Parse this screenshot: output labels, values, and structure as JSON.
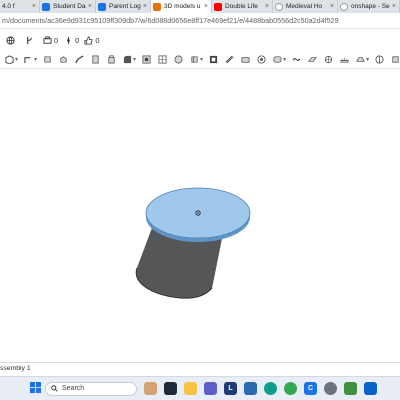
{
  "browser": {
    "tabs": [
      {
        "title": "4.0 f",
        "icon_color": "#3b78d8",
        "active": false
      },
      {
        "title": "Student Das",
        "icon_color": "#1a73e8",
        "active": false
      },
      {
        "title": "Parent LogV",
        "icon_color": "#1a73e8",
        "active": false
      },
      {
        "title": "3D models u",
        "icon_color": "#e8710a",
        "active": true
      },
      {
        "title": "Double Life",
        "icon_color": "#ff0000",
        "active": false
      },
      {
        "title": "Medieval Ho",
        "icon_color": "#9aa0a6",
        "active": false
      },
      {
        "title": "onshape - Se",
        "icon_color": "#9aa0a6",
        "active": false
      }
    ],
    "close_glyph": "×",
    "url": "m/documents/ac36e9d931c95109ff309db7/w/6d088d0656e8ff17e469ef21/e/4488bab0556d2c50a2d4f529"
  },
  "header": {
    "print_count": "0",
    "branch_count": "0",
    "like_count": "0"
  },
  "toolbar": {
    "icons": [
      "box-icon",
      "sketch-icon",
      "extrude-icon",
      "revolve-icon",
      "sweep-icon",
      "loft-icon",
      "thicken-icon",
      "fillet-icon",
      "chamfer-icon",
      "draft-icon",
      "shell-icon",
      "hole-icon",
      "boolean-icon",
      "split-icon",
      "transform-icon",
      "pattern-icon",
      "mirror-icon",
      "helix-icon",
      "plane-icon",
      "mate-connector-icon",
      "measure-icon",
      "view-icon",
      "section-icon",
      "appearance-icon",
      "sheet-metal-icon",
      "part-studio-icon",
      "more-icon",
      "options-icon"
    ]
  },
  "model": {
    "top_face_color": "#9fc8ec",
    "edge_color": "#5e95c9",
    "body_color": "#545657",
    "shade_color": "#2f3132"
  },
  "bottom_tab": {
    "label": "ssembly 1"
  },
  "taskbar": {
    "search_label": "Search",
    "apps": [
      {
        "name": "widgets-icon",
        "color": "#3b82f6",
        "glyph": ""
      },
      {
        "name": "task-view-icon",
        "color": "#1e293b",
        "glyph": ""
      },
      {
        "name": "explorer-icon",
        "color": "#f6c343",
        "glyph": ""
      },
      {
        "name": "teams-icon",
        "color": "#5b5fc7",
        "glyph": ""
      },
      {
        "name": "l-app-icon",
        "color": "#1f3b73",
        "glyph": "L"
      },
      {
        "name": "store-icon",
        "color": "#2b6cb0",
        "glyph": ""
      },
      {
        "name": "edge-icon",
        "color": "#0e9f8a",
        "glyph": ""
      },
      {
        "name": "chrome-icon",
        "color": "#34a853",
        "glyph": ""
      },
      {
        "name": "c-app-icon",
        "color": "#1a73e8",
        "glyph": "C"
      },
      {
        "name": "settings-icon",
        "color": "#6b7280",
        "glyph": ""
      },
      {
        "name": "minecraft-icon",
        "color": "#3f8f3f",
        "glyph": ""
      },
      {
        "name": "outlook-icon",
        "color": "#0a64c8",
        "glyph": ""
      }
    ]
  }
}
